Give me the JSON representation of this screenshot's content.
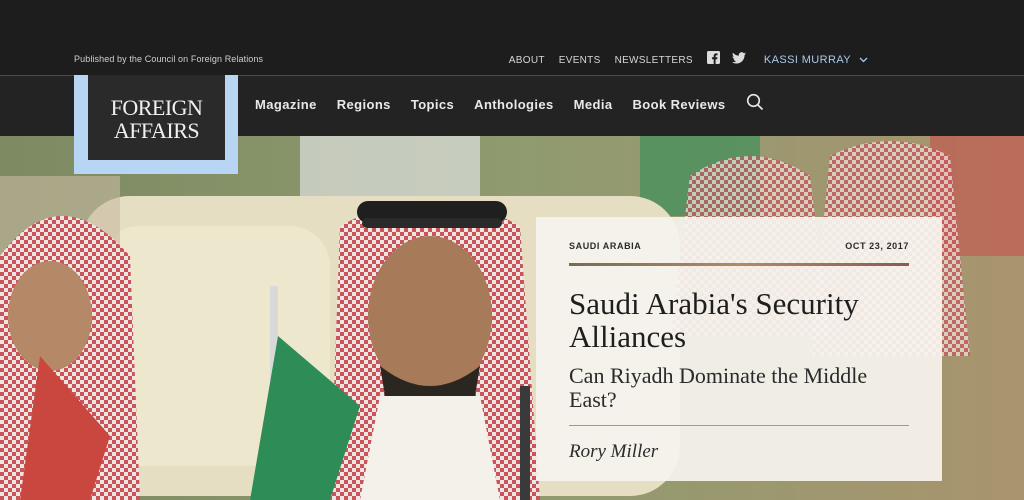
{
  "topbar": {
    "published": "Published by the Council on Foreign Relations",
    "links": [
      "ABOUT",
      "EVENTS",
      "NEWSLETTERS"
    ],
    "social": [
      "facebook-icon",
      "twitter-icon"
    ],
    "user_name": "KASSI MURRAY"
  },
  "logo": {
    "line1": "FOREIGN",
    "line2": "AFFAIRS"
  },
  "nav": {
    "items": [
      "Magazine",
      "Regions",
      "Topics",
      "Anthologies",
      "Media",
      "Book Reviews"
    ],
    "search_icon": "search-icon"
  },
  "article": {
    "region": "SAUDI ARABIA",
    "date": "OCT 23, 2017",
    "title": "Saudi Arabia's Security Alliances",
    "subtitle": "Can Riyadh Dominate the Middle East?",
    "author": "Rory Miller"
  },
  "colors": {
    "accent": "#a9c9ec",
    "logo_frame": "#b9d5f4",
    "dark_bg": "#1d1d1d",
    "nav_bg": "#232323"
  }
}
